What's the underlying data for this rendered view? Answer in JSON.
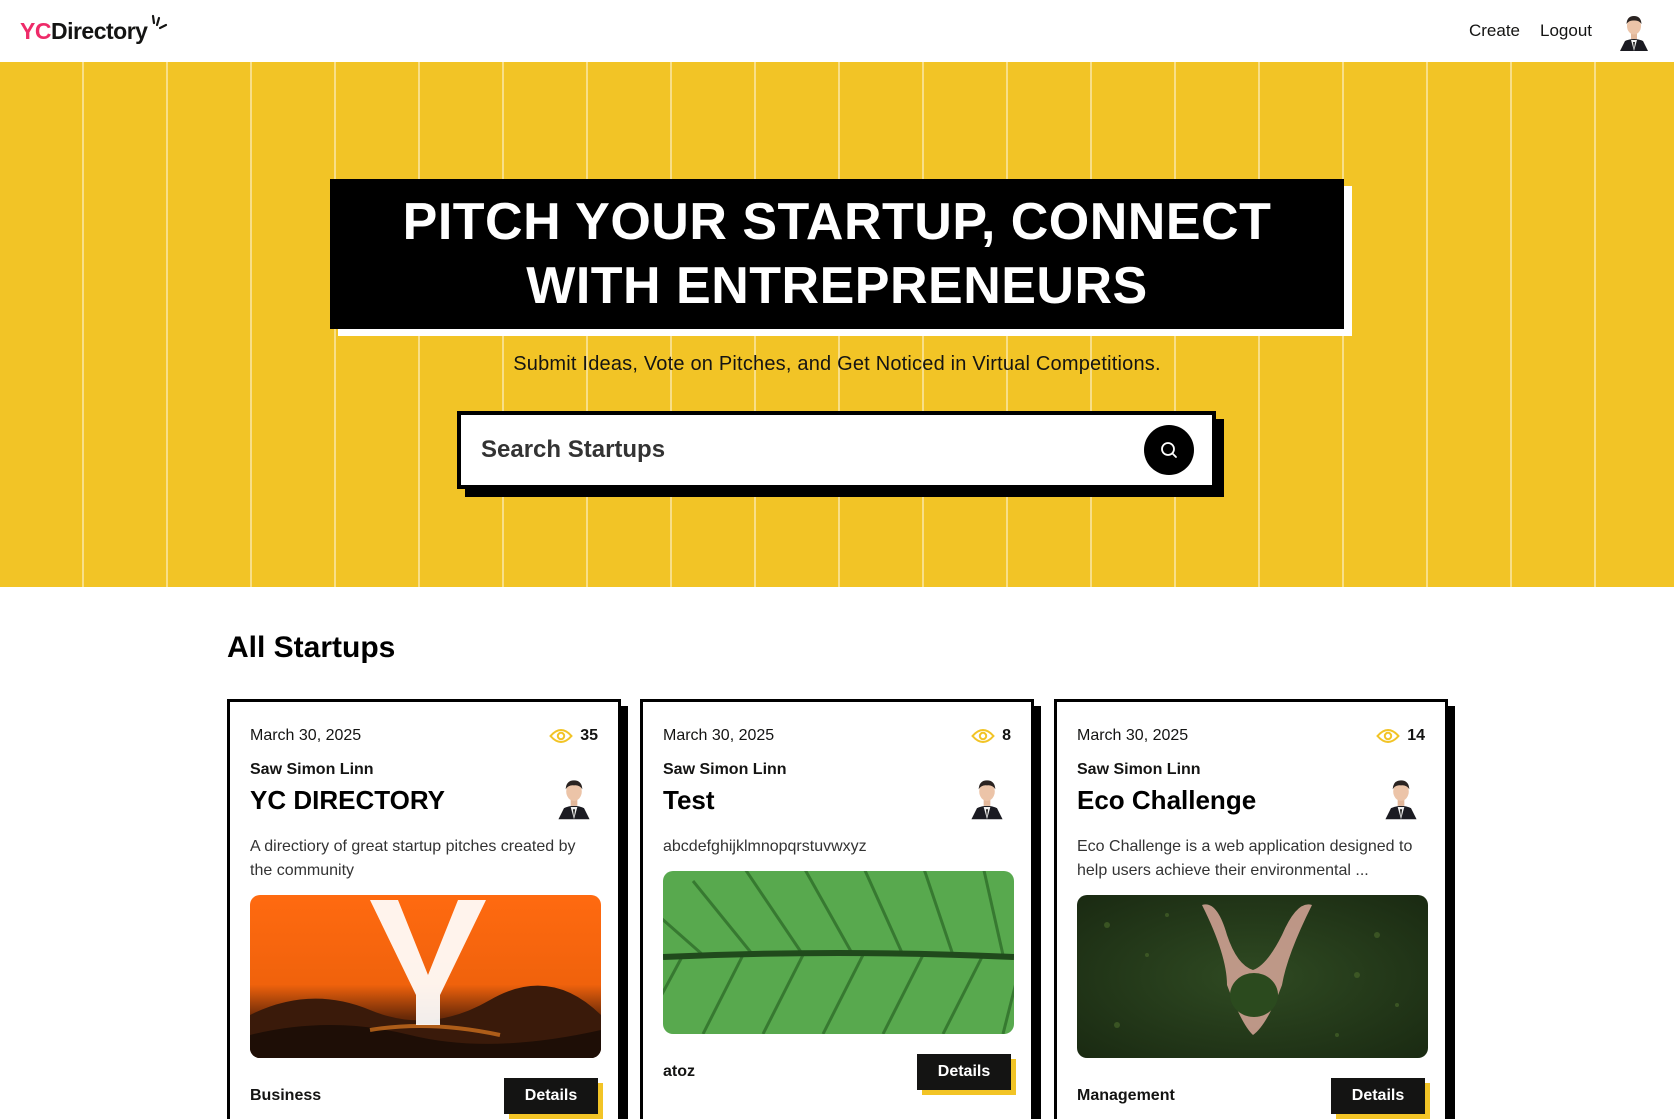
{
  "brand": {
    "yc": "YC",
    "directory": "Directory",
    "pink": "#ee2b69",
    "yellow": "#f2c426"
  },
  "nav": {
    "create": "Create",
    "logout": "Logout",
    "avatar_icon": "user-avatar"
  },
  "hero": {
    "title_line1": "PITCH YOUR STARTUP, CONNECT",
    "title_line2": "WITH ENTREPRENEURS",
    "subtitle": "Submit Ideas, Vote on Pitches, and Get Noticed in Virtual Competitions.",
    "search_placeholder": "Search Startups",
    "search_icon": "search-icon"
  },
  "section": {
    "title": "All Startups"
  },
  "startups": [
    {
      "date": "March 30, 2025",
      "views": "35",
      "author": "Saw Simon Linn",
      "title": "YC DIRECTORY",
      "description": "A directiory of great startup pitches created by the community",
      "image": "orange-y-logo",
      "category": "Business",
      "details": "Details"
    },
    {
      "date": "March 30, 2025",
      "views": "8",
      "author": "Saw Simon Linn",
      "title": "Test",
      "description": "abcdefghijklmnopqrstuvwxyz",
      "image": "green-leaf",
      "category": "atoz",
      "details": "Details"
    },
    {
      "date": "March 30, 2025",
      "views": "14",
      "author": "Saw Simon Linn",
      "title": "Eco Challenge",
      "description": "Eco Challenge is a web application designed to help users achieve their environmental ...",
      "image": "hands-holding-soil",
      "category": "Management",
      "details": "Details"
    }
  ]
}
